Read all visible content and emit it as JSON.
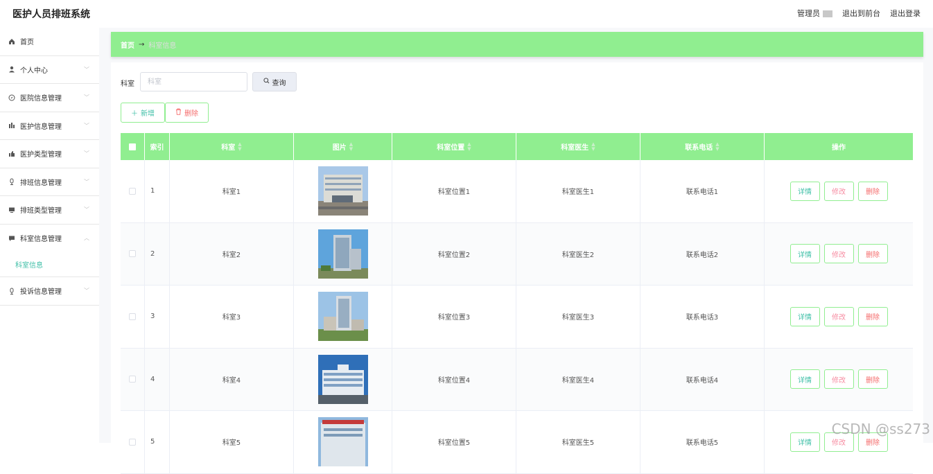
{
  "app": {
    "title": "医护人员排班系统",
    "user_label": "管理员",
    "links": [
      "退出到前台",
      "退出登录"
    ]
  },
  "sidebar": {
    "items": [
      {
        "label": "首页",
        "icon": "home-icon",
        "chevron": false
      },
      {
        "label": "个人中心",
        "icon": "user-icon",
        "chevron": true
      },
      {
        "label": "医院信息管理",
        "icon": "compass-icon",
        "chevron": true
      },
      {
        "label": "医护信息管理",
        "icon": "chart-icon",
        "chevron": true
      },
      {
        "label": "医护类型管理",
        "icon": "thumb-icon",
        "chevron": true
      },
      {
        "label": "排班信息管理",
        "icon": "mic-icon",
        "chevron": true
      },
      {
        "label": "排班类型管理",
        "icon": "monitor-icon",
        "chevron": true
      },
      {
        "label": "科室信息管理",
        "icon": "chat-icon",
        "chevron": true,
        "expanded": true
      },
      {
        "label": "投诉信息管理",
        "icon": "mic-icon",
        "chevron": true
      }
    ],
    "active_sub": "科室信息"
  },
  "breadcrumb": {
    "home": "首页",
    "arrow": "→",
    "current": "科室信息"
  },
  "search": {
    "label": "科室",
    "placeholder": "科室",
    "button": "查询"
  },
  "actions": {
    "add": "新增",
    "delete": "删除"
  },
  "table": {
    "headers": [
      "索引",
      "科室",
      "图片",
      "科室位置",
      "科室医生",
      "联系电话",
      "操作"
    ],
    "op_labels": {
      "detail": "详情",
      "edit": "修改",
      "delete": "删除"
    },
    "rows": [
      {
        "index": "1",
        "ks": "科室1",
        "loc": "科室位置1",
        "doc": "科室医生1",
        "tel": "联系电话1"
      },
      {
        "index": "2",
        "ks": "科室2",
        "loc": "科室位置2",
        "doc": "科室医生2",
        "tel": "联系电话2"
      },
      {
        "index": "3",
        "ks": "科室3",
        "loc": "科室位置3",
        "doc": "科室医生3",
        "tel": "联系电话3"
      },
      {
        "index": "4",
        "ks": "科室4",
        "loc": "科室位置4",
        "doc": "科室医生4",
        "tel": "联系电话4"
      },
      {
        "index": "5",
        "ks": "科室5",
        "loc": "科室位置5",
        "doc": "科室医生5",
        "tel": "联系电话5"
      }
    ]
  },
  "colors": {
    "accent": "#90ee90",
    "primary_text": "#3fbfa7",
    "danger": "#f56c6c"
  },
  "watermark": "CSDN @ss273"
}
